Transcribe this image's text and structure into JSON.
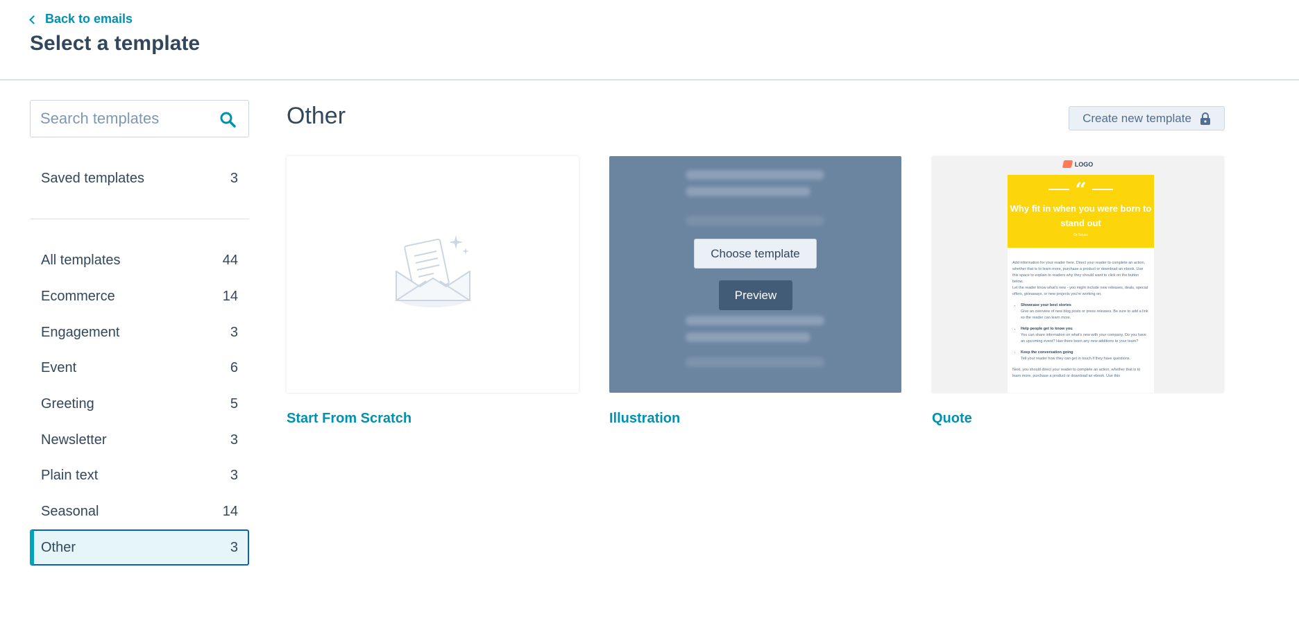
{
  "header": {
    "back_label": "Back to emails",
    "title": "Select a template"
  },
  "sidebar": {
    "search_placeholder": "Search templates",
    "saved": {
      "label": "Saved templates",
      "count": "3"
    },
    "categories": [
      {
        "label": "All templates",
        "count": "44"
      },
      {
        "label": "Ecommerce",
        "count": "14"
      },
      {
        "label": "Engagement",
        "count": "3"
      },
      {
        "label": "Event",
        "count": "6"
      },
      {
        "label": "Greeting",
        "count": "5"
      },
      {
        "label": "Newsletter",
        "count": "3"
      },
      {
        "label": "Plain text",
        "count": "3"
      },
      {
        "label": "Seasonal",
        "count": "14"
      },
      {
        "label": "Other",
        "count": "3"
      }
    ],
    "active_category": "Other"
  },
  "main": {
    "section_title": "Other",
    "create_button": "Create new template",
    "cards": [
      {
        "title": "Start From Scratch"
      },
      {
        "title": "Illustration",
        "choose_label": "Choose template",
        "preview_label": "Preview"
      },
      {
        "title": "Quote"
      }
    ],
    "quote_preview": {
      "logo": "LOGO",
      "headline": "Why fit in when you were born to stand out",
      "author": "Dr Seuss",
      "para1": "Add information for your reader here. Direct your reader to complete an action, whether that is to learn more, purchase a product or download an ebook. Use this space to explain to readers why they should want to click on the button below.",
      "para2": "Let the reader know what's new - you might include new releases, deals, special offers, giveaways, or new projects you're working on.",
      "bullets": [
        {
          "title": "Showcase your best stories",
          "text": "Give an overview of new blog posts or press releases. Be sure to add a link so the reader can learn more."
        },
        {
          "title": "Help people get to know you",
          "text": "You can share information on what's new with your company. Do you have an upcoming event? Has there been any new additions to your team?"
        },
        {
          "title": "Keep the conversation going",
          "text": "Tell your reader how they can get in touch if they have questions."
        }
      ],
      "para3": "Next, you should direct your reader to complete an action, whether that is to learn more, purchase a product or download an ebook. Use this"
    }
  },
  "colors": {
    "accent": "#0091ae",
    "text": "#33475b",
    "active_border": "#0b5fbd",
    "overlay": "#6b84a0",
    "quote_yellow": "#fcd50a"
  }
}
